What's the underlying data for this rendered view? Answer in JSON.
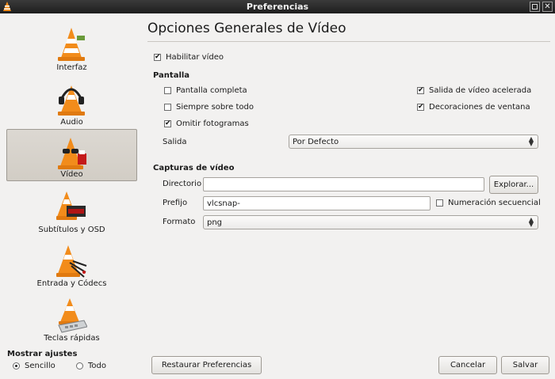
{
  "window": {
    "title": "Preferencias"
  },
  "sidebar": {
    "items": [
      {
        "label": "Interfaz",
        "icon": "cone-interface-icon"
      },
      {
        "label": "Audio",
        "icon": "cone-headphones-icon"
      },
      {
        "label": "Vídeo",
        "icon": "cone-glasses-icon"
      },
      {
        "label": "Subtítulos y OSD",
        "icon": "cone-subtitles-icon"
      },
      {
        "label": "Entrada y Códecs",
        "icon": "cone-cables-icon"
      },
      {
        "label": "Teclas rápidas",
        "icon": "cone-keyboard-icon"
      }
    ],
    "selected": "Vídeo"
  },
  "ajustes": {
    "title": "Mostrar ajustes",
    "simple": "Sencillo",
    "all": "Todo",
    "selected": "Sencillo"
  },
  "main": {
    "heading": "Opciones Generales de Vídeo",
    "enable_video": {
      "label": "Habilitar vídeo",
      "checked": true
    },
    "display": {
      "title": "Pantalla",
      "fullscreen": {
        "label": "Pantalla completa",
        "checked": false
      },
      "on_top": {
        "label": "Siempre sobre todo",
        "checked": false
      },
      "drop_frames": {
        "label": "Omitir fotogramas",
        "checked": true
      },
      "accel": {
        "label": "Salida de vídeo acelerada",
        "checked": true
      },
      "decorations": {
        "label": "Decoraciones de ventana",
        "checked": true
      },
      "output_label": "Salida",
      "output_value": "Por Defecto"
    },
    "snapshots": {
      "title": "Capturas de vídeo",
      "dir_label": "Directorio",
      "dir_value": "",
      "browse": "Explorar...",
      "prefix_label": "Prefijo",
      "prefix_value": "vlcsnap-",
      "sequential": {
        "label": "Numeración secuencial",
        "checked": false
      },
      "format_label": "Formato",
      "format_value": "png"
    }
  },
  "footer": {
    "reset": "Restaurar Preferencias",
    "cancel": "Cancelar",
    "save": "Salvar"
  },
  "colors": {
    "cone_orange": "#f28c1b",
    "selected_bg": "#d6d2cb",
    "titlebar": "#262626"
  }
}
